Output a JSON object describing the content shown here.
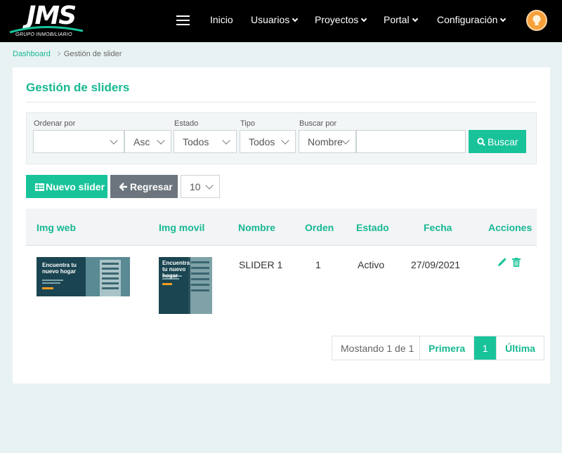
{
  "brand": {
    "logo_text": "JMS",
    "logo_subtitle": "GRUPO INMOBILIARIO"
  },
  "nav": {
    "items": [
      {
        "label": "Inicio",
        "has_dropdown": false
      },
      {
        "label": "Usuarios",
        "has_dropdown": true
      },
      {
        "label": "Proyectos",
        "has_dropdown": true
      },
      {
        "label": "Portal",
        "has_dropdown": true
      },
      {
        "label": "Configuración",
        "has_dropdown": true
      }
    ]
  },
  "breadcrumb": {
    "home": "Dashboard",
    "current": "Gestión de slider"
  },
  "page": {
    "title": "Gestión de sliders"
  },
  "filters": {
    "order_label": "Ordenar por",
    "order_value": "",
    "direction_value": "Asc",
    "estado_label": "Estado",
    "estado_value": "Todos",
    "tipo_label": "Tipo",
    "tipo_value": "Todos",
    "buscar_label": "Buscar por",
    "buscar_field_value": "Nombre",
    "search_value": "",
    "search_button": "Buscar"
  },
  "toolbar": {
    "new_label": "Nuevo slider",
    "back_label": "Regresar",
    "per_page": "10"
  },
  "table": {
    "headers": [
      "Img web",
      "Img movil",
      "Nombre",
      "Orden",
      "Estado",
      "Fecha",
      "Acciones"
    ],
    "rows": [
      {
        "img_web_text": "Encuentra tu nuevo hogar",
        "img_movil_text": "Encuentra tu nuevo hogar",
        "nombre": "SLIDER 1",
        "orden": "1",
        "estado": "Activo",
        "fecha": "27/09/2021"
      }
    ]
  },
  "pagination": {
    "info": "Mostando 1 de 1",
    "first": "Primera",
    "current": "1",
    "last": "Última"
  },
  "colors": {
    "accent": "#18c39a",
    "navbar": "#000000",
    "secondary_button": "#6c757d",
    "background": "#e8f2f3"
  }
}
